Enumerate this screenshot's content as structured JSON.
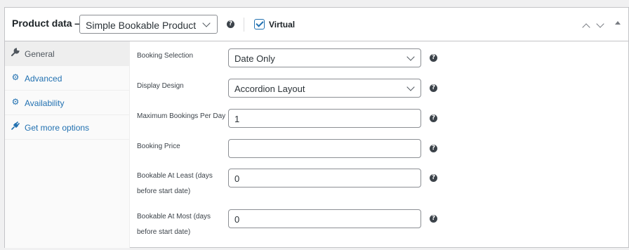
{
  "header": {
    "title": "Product data —",
    "product_type": "Simple Bookable Product",
    "help_icon": "help-icon",
    "virtual_label": "Virtual",
    "virtual_checked": true
  },
  "tabs": [
    {
      "label": "General",
      "icon": "wrench-icon",
      "active": true
    },
    {
      "label": "Advanced",
      "icon": "gear-icon",
      "active": false
    },
    {
      "label": "Availability",
      "icon": "gear-icon",
      "active": false
    },
    {
      "label": "Get more options",
      "icon": "plug-icon",
      "active": false
    }
  ],
  "fields": {
    "booking_selection": {
      "label": "Booking Selection",
      "value": "Date Only"
    },
    "display_design": {
      "label": "Display Design",
      "value": "Accordion Layout"
    },
    "max_bookings": {
      "label": "Maximum Bookings Per Day",
      "value": "1"
    },
    "booking_price": {
      "label": "Booking Price",
      "value": ""
    },
    "bookable_least": {
      "label_line1": "Bookable At Least (days",
      "label_line2": "before start date)",
      "value": "0"
    },
    "bookable_most": {
      "label_line1": "Bookable At Most (days",
      "label_line2": "before start date)",
      "value": "0"
    }
  },
  "colors": {
    "accent": "#2271b1",
    "border": "#c3c4c7",
    "background": "#f0f0f1"
  }
}
